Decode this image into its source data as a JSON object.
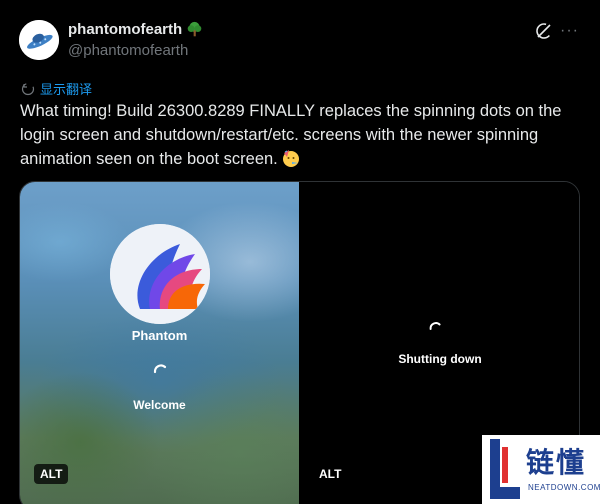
{
  "tweet": {
    "display_name": "phantomofearth",
    "handle": "@phantomofearth",
    "translate_label": "显示翻译",
    "text": "What timing! Build 26300.8289 FINALLY replaces the spinning dots on the login screen and shutdown/restart/etc. screens with the newer spinning animation seen on the boot screen.",
    "emoji": "face-with-party-horn-icon"
  },
  "media": {
    "left": {
      "user_name": "Phantom",
      "status": "Welcome",
      "alt_label": "ALT"
    },
    "right": {
      "status": "Shutting down",
      "alt_label": "ALT"
    }
  },
  "watermark": {
    "brand_cn": "链懂",
    "brand_en": "NEATDOWN.COM"
  },
  "colors": {
    "background": "#000000",
    "text": "#e7e9ea",
    "muted": "#71767b",
    "link": "#1d9bf0",
    "border": "#2f3336"
  }
}
